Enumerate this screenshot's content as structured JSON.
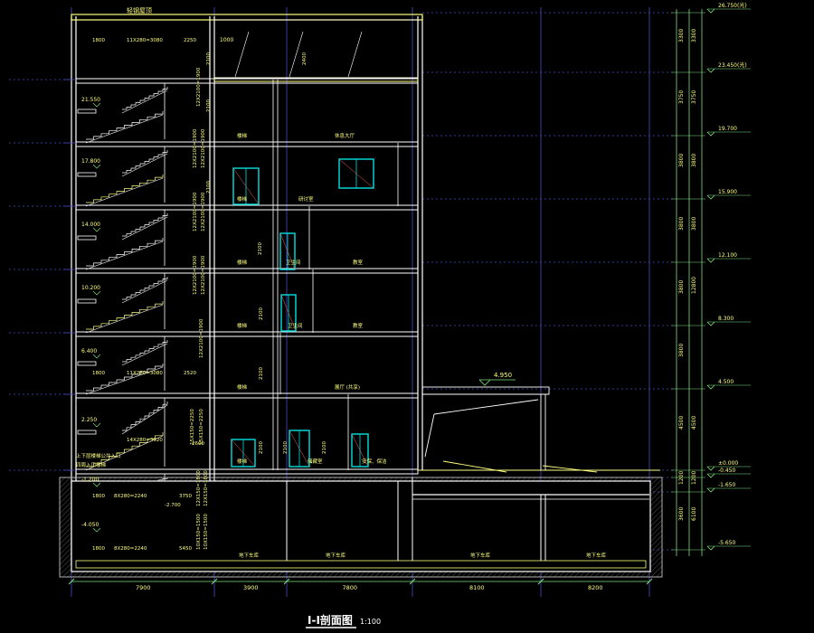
{
  "title": {
    "text": "I-I剖面图",
    "scale": "1:100"
  },
  "roof_label": "轻钢屋顶",
  "elevations": [
    {
      "value": "26.750(光)"
    },
    {
      "value": "23.450(光)"
    },
    {
      "value": "19.700"
    },
    {
      "value": "15.900"
    },
    {
      "value": "12.100"
    },
    {
      "value": "8.300"
    },
    {
      "value": "4.500"
    },
    {
      "value": "±0.000"
    },
    {
      "value": "-0.450"
    },
    {
      "value": "-1.650"
    },
    {
      "value": "-5.650"
    }
  ],
  "stair_levels": [
    {
      "value": "21.550"
    },
    {
      "value": "17.800"
    },
    {
      "value": "14.000"
    },
    {
      "value": "10.200"
    },
    {
      "value": "6.400"
    },
    {
      "value": "2.250"
    },
    {
      "value": "-1.200"
    },
    {
      "value": "-4.050"
    }
  ],
  "right_dims_inner": [
    "3300",
    "3750",
    "3800",
    "3800",
    "3800",
    "3800",
    "4500",
    "1200",
    "3600"
  ],
  "right_dims_outer": [
    "3300",
    "3750",
    "3800",
    "3800",
    "12800",
    "4500",
    "1200",
    "6100"
  ],
  "bottom_dims": [
    "7900",
    "3900",
    "7800",
    "8100",
    "8200"
  ],
  "room_labels": [
    {
      "text": "楼梯"
    },
    {
      "text": "休息大厅"
    },
    {
      "text": "楼梯"
    },
    {
      "text": "研讨室"
    },
    {
      "text": "楼梯"
    },
    {
      "text": "卫生间"
    },
    {
      "text": "教室"
    },
    {
      "text": "楼梯"
    },
    {
      "text": "卫生间"
    },
    {
      "text": "教室"
    },
    {
      "text": "楼梯"
    },
    {
      "text": "展厅 (共享)"
    },
    {
      "text": "楼梯"
    },
    {
      "text": "储藏室"
    },
    {
      "text": "安保、保洁"
    },
    {
      "text": "地下车库"
    },
    {
      "text": "地下车库"
    },
    {
      "text": "地下车库"
    },
    {
      "text": "地下车库"
    }
  ],
  "stair_dim_labels": [
    "1800",
    "11X280=3080",
    "2250",
    "12X2100=1900",
    "12X2100=1900",
    "12X2100=1900",
    "12X2100=1900",
    "12X2100=1900",
    "12X2100=1900",
    "12X2100=1900",
    "12X2100=1900",
    "1800",
    "11X280=3080",
    "2520",
    "15X150=2250",
    "15X150=2250",
    "上下层楼梯公共入口",
    "四周入口楼梯",
    "14X280=3920",
    "2600",
    "1800",
    "8X280=2240",
    "-2.700",
    "3750",
    "12X150=1800",
    "12X150=1800",
    "1800",
    "8X280=2240",
    "5450",
    "10X150=1500",
    "10X150=1500"
  ],
  "door_heights": [
    "2400",
    "2100",
    "2100",
    "2100",
    "2100",
    "2100",
    "2100",
    "2100",
    "2100",
    "2100"
  ],
  "canopy_level": "4.950",
  "top_dim_left": "1000",
  "colors": {
    "bg": "#000000",
    "structure": "#ffffff",
    "grid": "#4a4ac8",
    "dim": "#7fe07f",
    "annot": "#ffff7f",
    "opening": "#00e0e0",
    "soil": "#b0b0b0"
  }
}
